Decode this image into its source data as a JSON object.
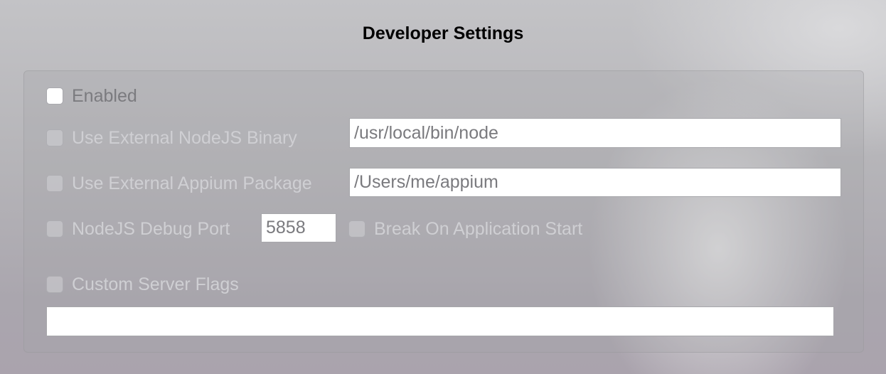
{
  "window": {
    "title": "Developer Settings"
  },
  "settings": {
    "enabled": {
      "label": "Enabled",
      "checked": false
    },
    "node_binary": {
      "label": "Use External NodeJS Binary",
      "checked": false,
      "value": "/usr/local/bin/node"
    },
    "appium_package": {
      "label": "Use External Appium Package",
      "checked": false,
      "value": "/Users/me/appium"
    },
    "debug_port": {
      "label": "NodeJS Debug Port",
      "checked": false,
      "value": "5858"
    },
    "break_on_start": {
      "label": "Break On Application Start",
      "checked": false
    },
    "custom_flags": {
      "label": "Custom Server Flags",
      "checked": false,
      "value": ""
    }
  },
  "colors": {
    "enabled_checkbox": "#ffffff",
    "disabled_label": "#cfcfd3",
    "active_label": "#7b7b7f",
    "field_text": "#7a7a7e"
  }
}
